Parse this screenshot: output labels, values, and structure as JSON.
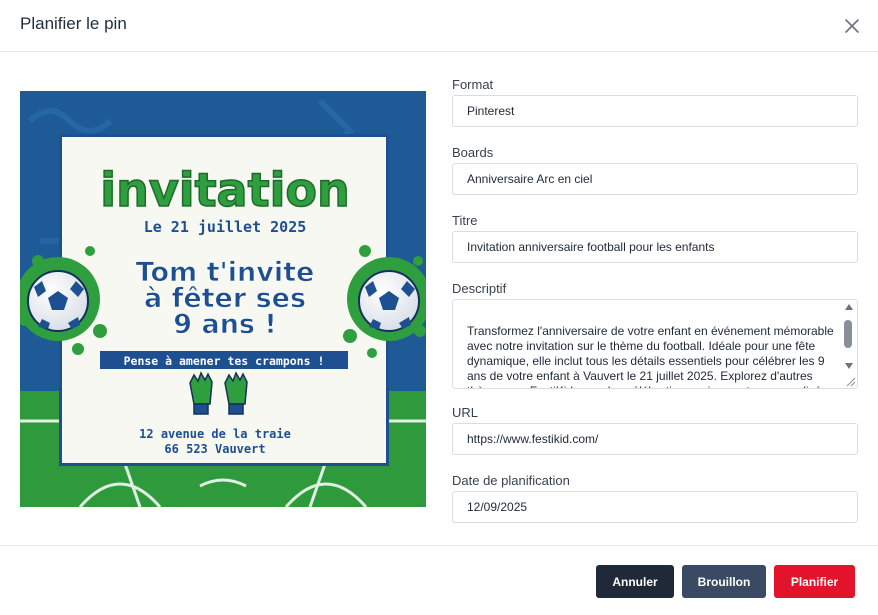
{
  "modal": {
    "title": "Planifier le pin"
  },
  "preview": {
    "heading": "invitation",
    "date": "Le 21 juillet 2025",
    "message_line1": "Tom t'invite",
    "message_line2": "à fêter ses",
    "message_line3": "9 ans !",
    "banner": "Pense à amener tes crampons !",
    "address_line1": "12 avenue de la traie",
    "address_line2": "66 523 Vauvert"
  },
  "form": {
    "format": {
      "label": "Format",
      "value": "Pinterest"
    },
    "boards": {
      "label": "Boards",
      "value": "Anniversaire Arc en ciel"
    },
    "titre": {
      "label": "Titre",
      "value": "Invitation anniversaire football pour les enfants"
    },
    "descriptif": {
      "label": "Descriptif",
      "value": "Transformez l'anniversaire de votre enfant en événement mémorable avec notre invitation sur le thème du football. Idéale pour une fête dynamique, elle inclut tous les détails essentiels pour célébrer les 9 ans de votre enfant à Vauvert le 21 juillet 2025. Explorez d'autres thèmes sur FestiKid pour des célébrations uniques et personnalisées."
    },
    "url": {
      "label": "URL",
      "value": "https://www.festikid.com/"
    },
    "date": {
      "label": "Date de planification",
      "value": "12/09/2025"
    }
  },
  "footer": {
    "cancel_label": "Annuler",
    "draft_label": "Brouillon",
    "schedule_label": "Planifier"
  },
  "colors": {
    "primary_red": "#e3132b",
    "dark_button": "#1f2937",
    "slate_button": "#3b4a63",
    "invite_green": "#2e9e3e",
    "invite_blue": "#1d4f91"
  }
}
